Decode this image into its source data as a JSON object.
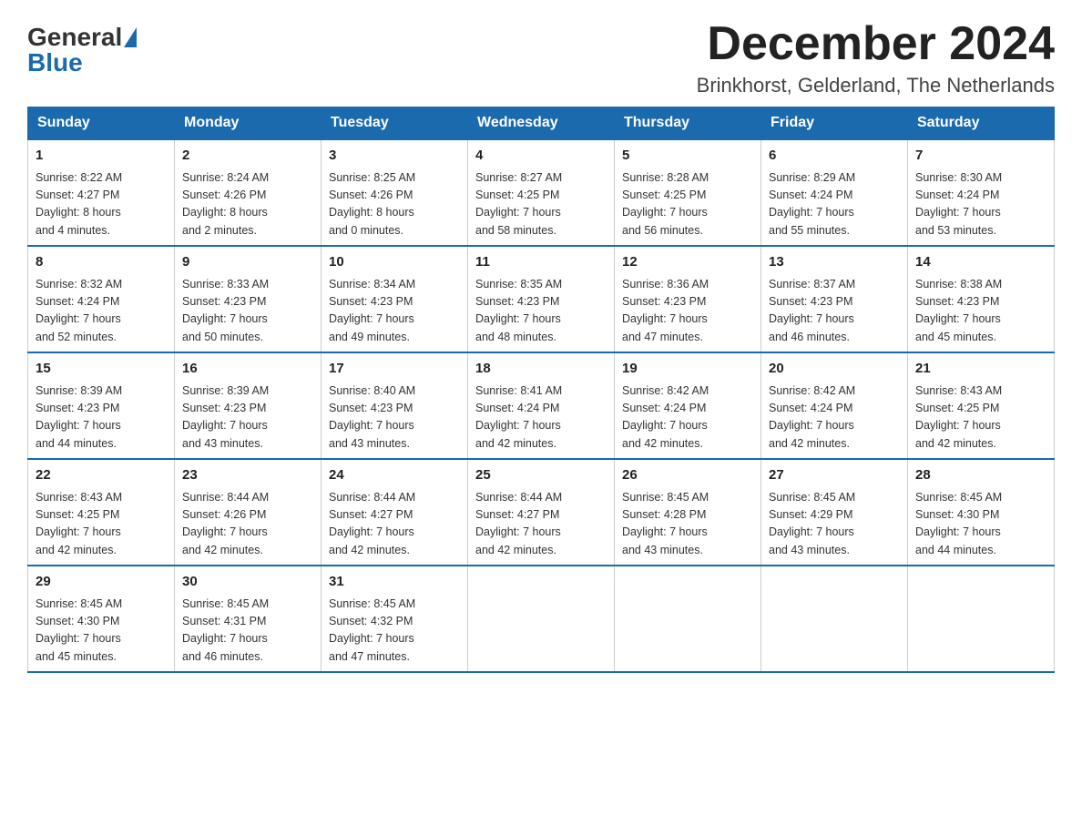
{
  "logo": {
    "general": "General",
    "blue": "Blue"
  },
  "title": "December 2024",
  "location": "Brinkhorst, Gelderland, The Netherlands",
  "weekdays": [
    "Sunday",
    "Monday",
    "Tuesday",
    "Wednesday",
    "Thursday",
    "Friday",
    "Saturday"
  ],
  "weeks": [
    [
      {
        "day": "1",
        "sunrise": "Sunrise: 8:22 AM",
        "sunset": "Sunset: 4:27 PM",
        "daylight": "Daylight: 8 hours",
        "daylight2": "and 4 minutes."
      },
      {
        "day": "2",
        "sunrise": "Sunrise: 8:24 AM",
        "sunset": "Sunset: 4:26 PM",
        "daylight": "Daylight: 8 hours",
        "daylight2": "and 2 minutes."
      },
      {
        "day": "3",
        "sunrise": "Sunrise: 8:25 AM",
        "sunset": "Sunset: 4:26 PM",
        "daylight": "Daylight: 8 hours",
        "daylight2": "and 0 minutes."
      },
      {
        "day": "4",
        "sunrise": "Sunrise: 8:27 AM",
        "sunset": "Sunset: 4:25 PM",
        "daylight": "Daylight: 7 hours",
        "daylight2": "and 58 minutes."
      },
      {
        "day": "5",
        "sunrise": "Sunrise: 8:28 AM",
        "sunset": "Sunset: 4:25 PM",
        "daylight": "Daylight: 7 hours",
        "daylight2": "and 56 minutes."
      },
      {
        "day": "6",
        "sunrise": "Sunrise: 8:29 AM",
        "sunset": "Sunset: 4:24 PM",
        "daylight": "Daylight: 7 hours",
        "daylight2": "and 55 minutes."
      },
      {
        "day": "7",
        "sunrise": "Sunrise: 8:30 AM",
        "sunset": "Sunset: 4:24 PM",
        "daylight": "Daylight: 7 hours",
        "daylight2": "and 53 minutes."
      }
    ],
    [
      {
        "day": "8",
        "sunrise": "Sunrise: 8:32 AM",
        "sunset": "Sunset: 4:24 PM",
        "daylight": "Daylight: 7 hours",
        "daylight2": "and 52 minutes."
      },
      {
        "day": "9",
        "sunrise": "Sunrise: 8:33 AM",
        "sunset": "Sunset: 4:23 PM",
        "daylight": "Daylight: 7 hours",
        "daylight2": "and 50 minutes."
      },
      {
        "day": "10",
        "sunrise": "Sunrise: 8:34 AM",
        "sunset": "Sunset: 4:23 PM",
        "daylight": "Daylight: 7 hours",
        "daylight2": "and 49 minutes."
      },
      {
        "day": "11",
        "sunrise": "Sunrise: 8:35 AM",
        "sunset": "Sunset: 4:23 PM",
        "daylight": "Daylight: 7 hours",
        "daylight2": "and 48 minutes."
      },
      {
        "day": "12",
        "sunrise": "Sunrise: 8:36 AM",
        "sunset": "Sunset: 4:23 PM",
        "daylight": "Daylight: 7 hours",
        "daylight2": "and 47 minutes."
      },
      {
        "day": "13",
        "sunrise": "Sunrise: 8:37 AM",
        "sunset": "Sunset: 4:23 PM",
        "daylight": "Daylight: 7 hours",
        "daylight2": "and 46 minutes."
      },
      {
        "day": "14",
        "sunrise": "Sunrise: 8:38 AM",
        "sunset": "Sunset: 4:23 PM",
        "daylight": "Daylight: 7 hours",
        "daylight2": "and 45 minutes."
      }
    ],
    [
      {
        "day": "15",
        "sunrise": "Sunrise: 8:39 AM",
        "sunset": "Sunset: 4:23 PM",
        "daylight": "Daylight: 7 hours",
        "daylight2": "and 44 minutes."
      },
      {
        "day": "16",
        "sunrise": "Sunrise: 8:39 AM",
        "sunset": "Sunset: 4:23 PM",
        "daylight": "Daylight: 7 hours",
        "daylight2": "and 43 minutes."
      },
      {
        "day": "17",
        "sunrise": "Sunrise: 8:40 AM",
        "sunset": "Sunset: 4:23 PM",
        "daylight": "Daylight: 7 hours",
        "daylight2": "and 43 minutes."
      },
      {
        "day": "18",
        "sunrise": "Sunrise: 8:41 AM",
        "sunset": "Sunset: 4:24 PM",
        "daylight": "Daylight: 7 hours",
        "daylight2": "and 42 minutes."
      },
      {
        "day": "19",
        "sunrise": "Sunrise: 8:42 AM",
        "sunset": "Sunset: 4:24 PM",
        "daylight": "Daylight: 7 hours",
        "daylight2": "and 42 minutes."
      },
      {
        "day": "20",
        "sunrise": "Sunrise: 8:42 AM",
        "sunset": "Sunset: 4:24 PM",
        "daylight": "Daylight: 7 hours",
        "daylight2": "and 42 minutes."
      },
      {
        "day": "21",
        "sunrise": "Sunrise: 8:43 AM",
        "sunset": "Sunset: 4:25 PM",
        "daylight": "Daylight: 7 hours",
        "daylight2": "and 42 minutes."
      }
    ],
    [
      {
        "day": "22",
        "sunrise": "Sunrise: 8:43 AM",
        "sunset": "Sunset: 4:25 PM",
        "daylight": "Daylight: 7 hours",
        "daylight2": "and 42 minutes."
      },
      {
        "day": "23",
        "sunrise": "Sunrise: 8:44 AM",
        "sunset": "Sunset: 4:26 PM",
        "daylight": "Daylight: 7 hours",
        "daylight2": "and 42 minutes."
      },
      {
        "day": "24",
        "sunrise": "Sunrise: 8:44 AM",
        "sunset": "Sunset: 4:27 PM",
        "daylight": "Daylight: 7 hours",
        "daylight2": "and 42 minutes."
      },
      {
        "day": "25",
        "sunrise": "Sunrise: 8:44 AM",
        "sunset": "Sunset: 4:27 PM",
        "daylight": "Daylight: 7 hours",
        "daylight2": "and 42 minutes."
      },
      {
        "day": "26",
        "sunrise": "Sunrise: 8:45 AM",
        "sunset": "Sunset: 4:28 PM",
        "daylight": "Daylight: 7 hours",
        "daylight2": "and 43 minutes."
      },
      {
        "day": "27",
        "sunrise": "Sunrise: 8:45 AM",
        "sunset": "Sunset: 4:29 PM",
        "daylight": "Daylight: 7 hours",
        "daylight2": "and 43 minutes."
      },
      {
        "day": "28",
        "sunrise": "Sunrise: 8:45 AM",
        "sunset": "Sunset: 4:30 PM",
        "daylight": "Daylight: 7 hours",
        "daylight2": "and 44 minutes."
      }
    ],
    [
      {
        "day": "29",
        "sunrise": "Sunrise: 8:45 AM",
        "sunset": "Sunset: 4:30 PM",
        "daylight": "Daylight: 7 hours",
        "daylight2": "and 45 minutes."
      },
      {
        "day": "30",
        "sunrise": "Sunrise: 8:45 AM",
        "sunset": "Sunset: 4:31 PM",
        "daylight": "Daylight: 7 hours",
        "daylight2": "and 46 minutes."
      },
      {
        "day": "31",
        "sunrise": "Sunrise: 8:45 AM",
        "sunset": "Sunset: 4:32 PM",
        "daylight": "Daylight: 7 hours",
        "daylight2": "and 47 minutes."
      },
      null,
      null,
      null,
      null
    ]
  ]
}
